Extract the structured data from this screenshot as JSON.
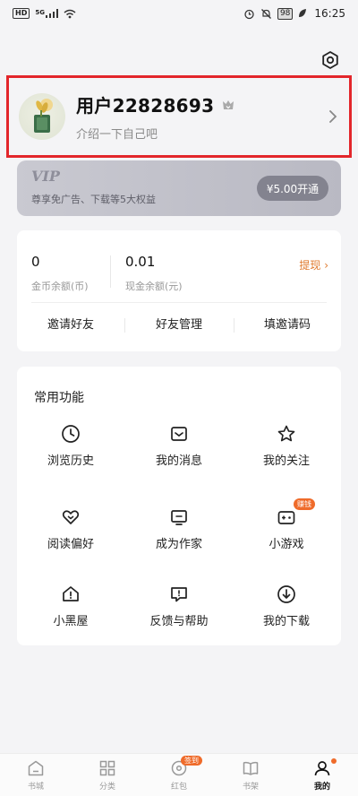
{
  "status_bar": {
    "hd": "HD",
    "signal": "5G",
    "battery": "98",
    "time": "16:25"
  },
  "profile": {
    "username": "用户22828693",
    "intro": "介绍一下自己吧"
  },
  "vip": {
    "title": "VIP",
    "subtitle": "尊享免广告、下载等5大权益",
    "button": "¥5.00开通"
  },
  "balance": {
    "coins_value": "0",
    "coins_label": "金币余额(币)",
    "cash_value": "0.01",
    "cash_label": "现金余额(元)",
    "withdraw": "提现 ›"
  },
  "actions": [
    "邀请好友",
    "好友管理",
    "填邀请码"
  ],
  "functions": {
    "title": "常用功能",
    "items": [
      {
        "label": "浏览历史",
        "icon": "clock-icon"
      },
      {
        "label": "我的消息",
        "icon": "message-icon"
      },
      {
        "label": "我的关注",
        "icon": "star-icon"
      },
      {
        "label": "阅读偏好",
        "icon": "heart-icon"
      },
      {
        "label": "成为作家",
        "icon": "monitor-icon"
      },
      {
        "label": "小游戏",
        "icon": "gamepad-icon",
        "badge": "赚钱"
      },
      {
        "label": "小黑屋",
        "icon": "house-alert-icon"
      },
      {
        "label": "反馈与帮助",
        "icon": "feedback-icon"
      },
      {
        "label": "我的下载",
        "icon": "download-icon"
      }
    ]
  },
  "tabbar": {
    "tabs": [
      {
        "label": "书城"
      },
      {
        "label": "分类"
      },
      {
        "label": "红包",
        "badge": "签到"
      },
      {
        "label": "书架"
      },
      {
        "label": "我的"
      }
    ]
  },
  "colors": {
    "accent": "#ef6b2a",
    "highlight_border": "#e3262b",
    "vip_bg": "#c4c4cc"
  }
}
